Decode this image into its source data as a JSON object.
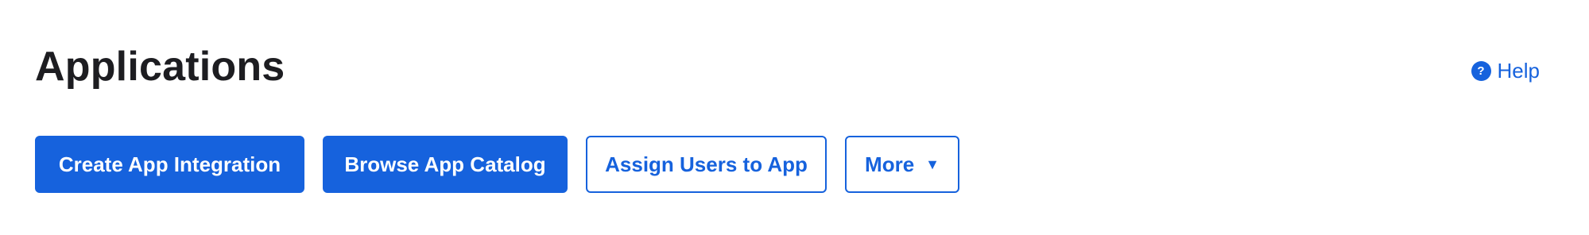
{
  "header": {
    "title": "Applications",
    "help_label": "Help",
    "help_icon": "question-circle-icon",
    "help_icon_glyph": "?"
  },
  "toolbar": {
    "create_label": "Create App Integration",
    "browse_label": "Browse App Catalog",
    "assign_label": "Assign Users to App",
    "more_label": "More",
    "more_icon": "caret-down-icon",
    "more_icon_glyph": "▼"
  },
  "colors": {
    "accent": "#1662dd",
    "title_text": "#1d1d21",
    "background": "#ffffff"
  }
}
